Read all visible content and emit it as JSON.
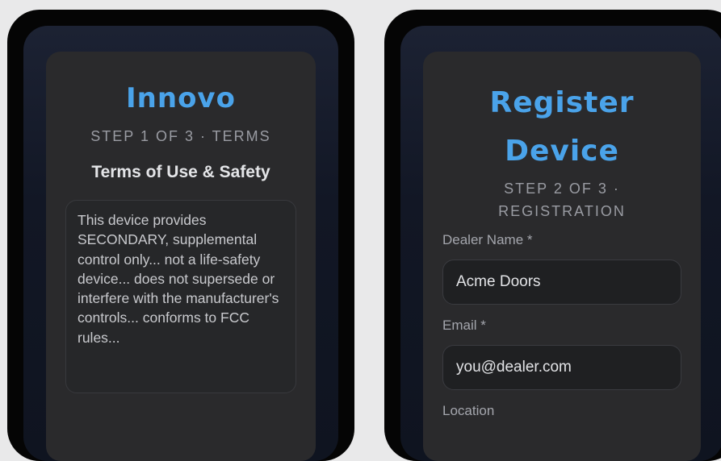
{
  "screen1": {
    "title": "Innovo",
    "step": "STEP 1 OF 3 · TERMS",
    "heading": "Terms of Use & Safety",
    "terms_text": "This device provides SECONDARY, supplemental control only... not a life-safety device... does not supersede or interfere with the manufacturer's controls... conforms to FCC rules..."
  },
  "screen2": {
    "title_line1": "Register",
    "title_line2": "Device",
    "step_line1": "STEP 2 OF 3 ·",
    "step_line2": "REGISTRATION",
    "fields": [
      {
        "label": "Dealer Name *",
        "value": "Acme Doors"
      },
      {
        "label": "Email *",
        "value": "you@dealer.com"
      },
      {
        "label": "Location",
        "value": ""
      }
    ]
  },
  "colors": {
    "accent": "#4aa3ea",
    "card": "#2a2a2c",
    "phone_frame": "#050505",
    "page_bg": "#e9e9ea"
  }
}
